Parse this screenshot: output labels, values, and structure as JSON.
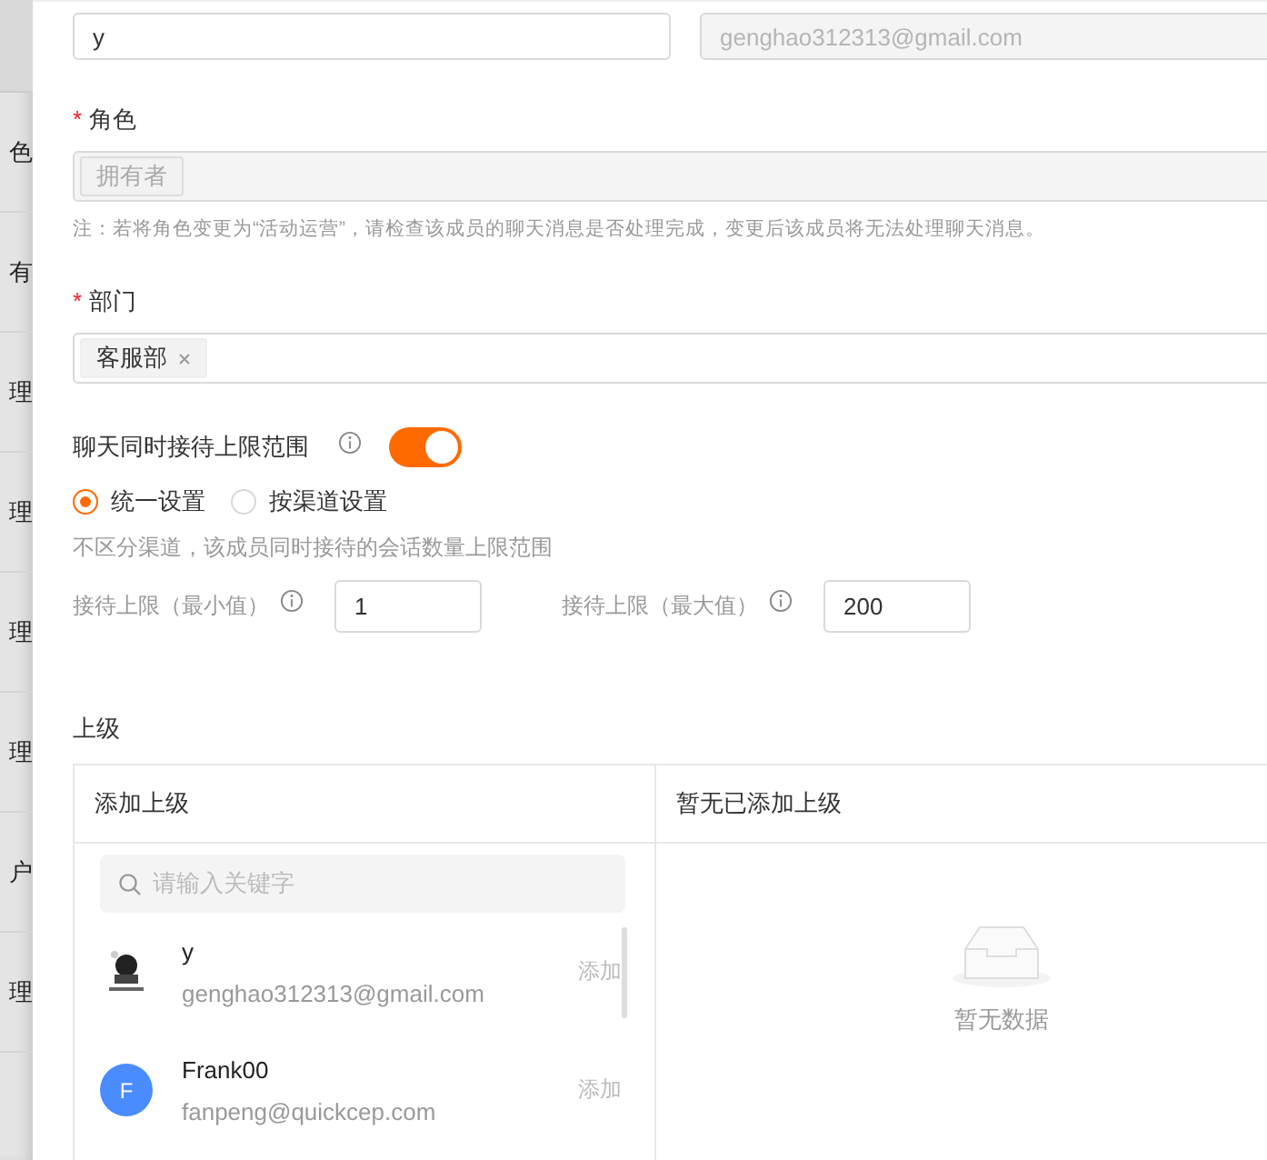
{
  "background_list": {
    "items": [
      "色",
      "有",
      "理",
      "理",
      "理",
      "理",
      "户",
      "理"
    ]
  },
  "form": {
    "required_mark": "*",
    "name": {
      "value": "y"
    },
    "email": {
      "value": "genghao312313@gmail.com",
      "disabled": true
    },
    "role": {
      "label": "角色",
      "required": true,
      "tags": [
        "拥有者"
      ],
      "disabled": true,
      "note": "注：若将角色变更为“活动运营”，请检查该成员的聊天消息是否处理完成，变更后该成员将无法处理聊天消息。"
    },
    "department": {
      "label": "部门",
      "required": true,
      "tags": [
        "客服部"
      ]
    },
    "chat_limit": {
      "label": "聊天同时接待上限范围",
      "on": true,
      "modes": [
        {
          "label": "统一设置",
          "selected": true
        },
        {
          "label": "按渠道设置",
          "selected": false
        }
      ],
      "hint": "不区分渠道，该成员同时接待的会话数量上限范围",
      "min": {
        "label": "接待上限（最小值）",
        "value": "1"
      },
      "max": {
        "label": "接待上限（最大值）",
        "value": "200"
      }
    },
    "superior": {
      "label": "上级",
      "left": {
        "title": "添加上级",
        "search_placeholder": "请输入关键字",
        "people": [
          {
            "kind": "picture",
            "name": "y",
            "email": "genghao312313@gmail.com",
            "action": "添加"
          },
          {
            "kind": "initial",
            "initial": "F",
            "name": "Frank00",
            "email": "fanpeng@quickcep.com",
            "action": "添加"
          }
        ]
      },
      "right": {
        "title": "暂无已添加上级",
        "empty_text": "暂无数据"
      }
    }
  }
}
